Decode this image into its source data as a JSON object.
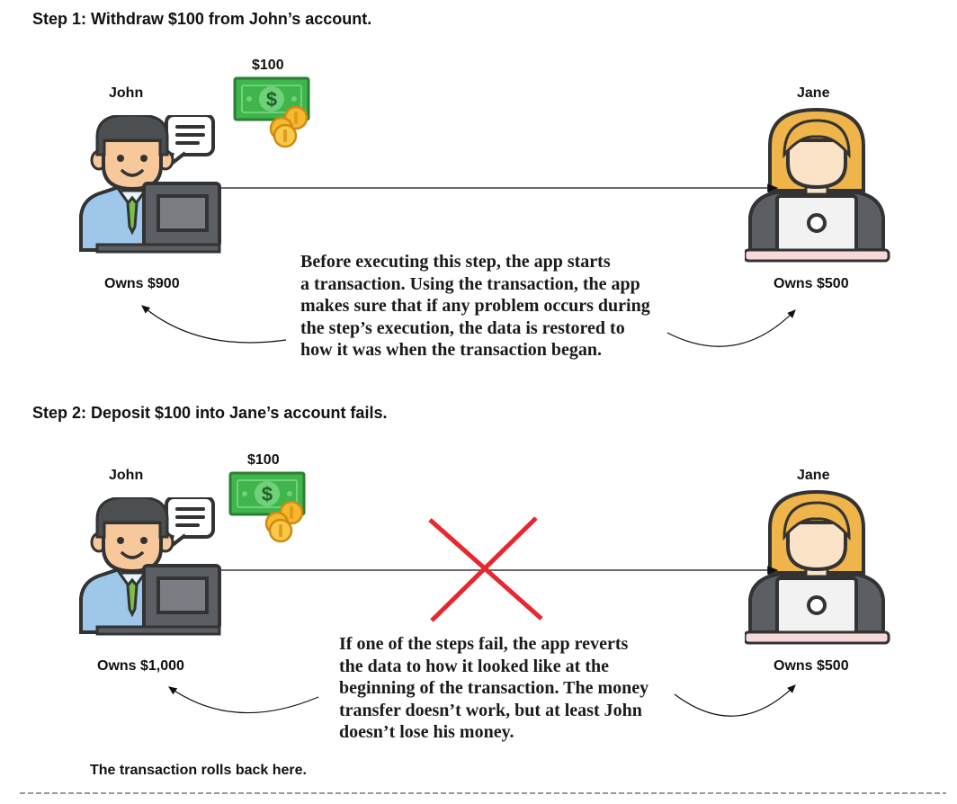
{
  "step1": {
    "title": "Step 1: Withdraw $100 from John’s account.",
    "john_name": "John",
    "jane_name": "Jane",
    "money_label": "$100",
    "john_balance": "Owns $900",
    "jane_balance": "Owns $500",
    "note_lines": [
      "Before executing this step, the app starts",
      "a transaction. Using the transaction, the app",
      "makes sure that if any problem occurs during",
      "the step’s execution, the data is restored to",
      "how it was when the transaction began."
    ]
  },
  "step2": {
    "title": "Step 2: Deposit $100 into Jane’s account fails.",
    "john_name": "John",
    "jane_name": "Jane",
    "money_label": "$100",
    "john_balance": "Owns $1,000",
    "jane_balance": "Owns $500",
    "note_lines": [
      "If one of the steps fail, the app reverts",
      "the data to how it looked like at the",
      "beginning of the transaction. The money",
      "transfer doesn’t work, but at least John",
      "doesn’t lose his money."
    ]
  },
  "footer": "The transaction rolls back here.",
  "colors": {
    "failure_cross": "#e8262d",
    "money_green": "#3fb54c",
    "coin_gold": "#f5b82e",
    "jane_hair": "#f0b54a",
    "john_hair": "#4b4f52"
  }
}
